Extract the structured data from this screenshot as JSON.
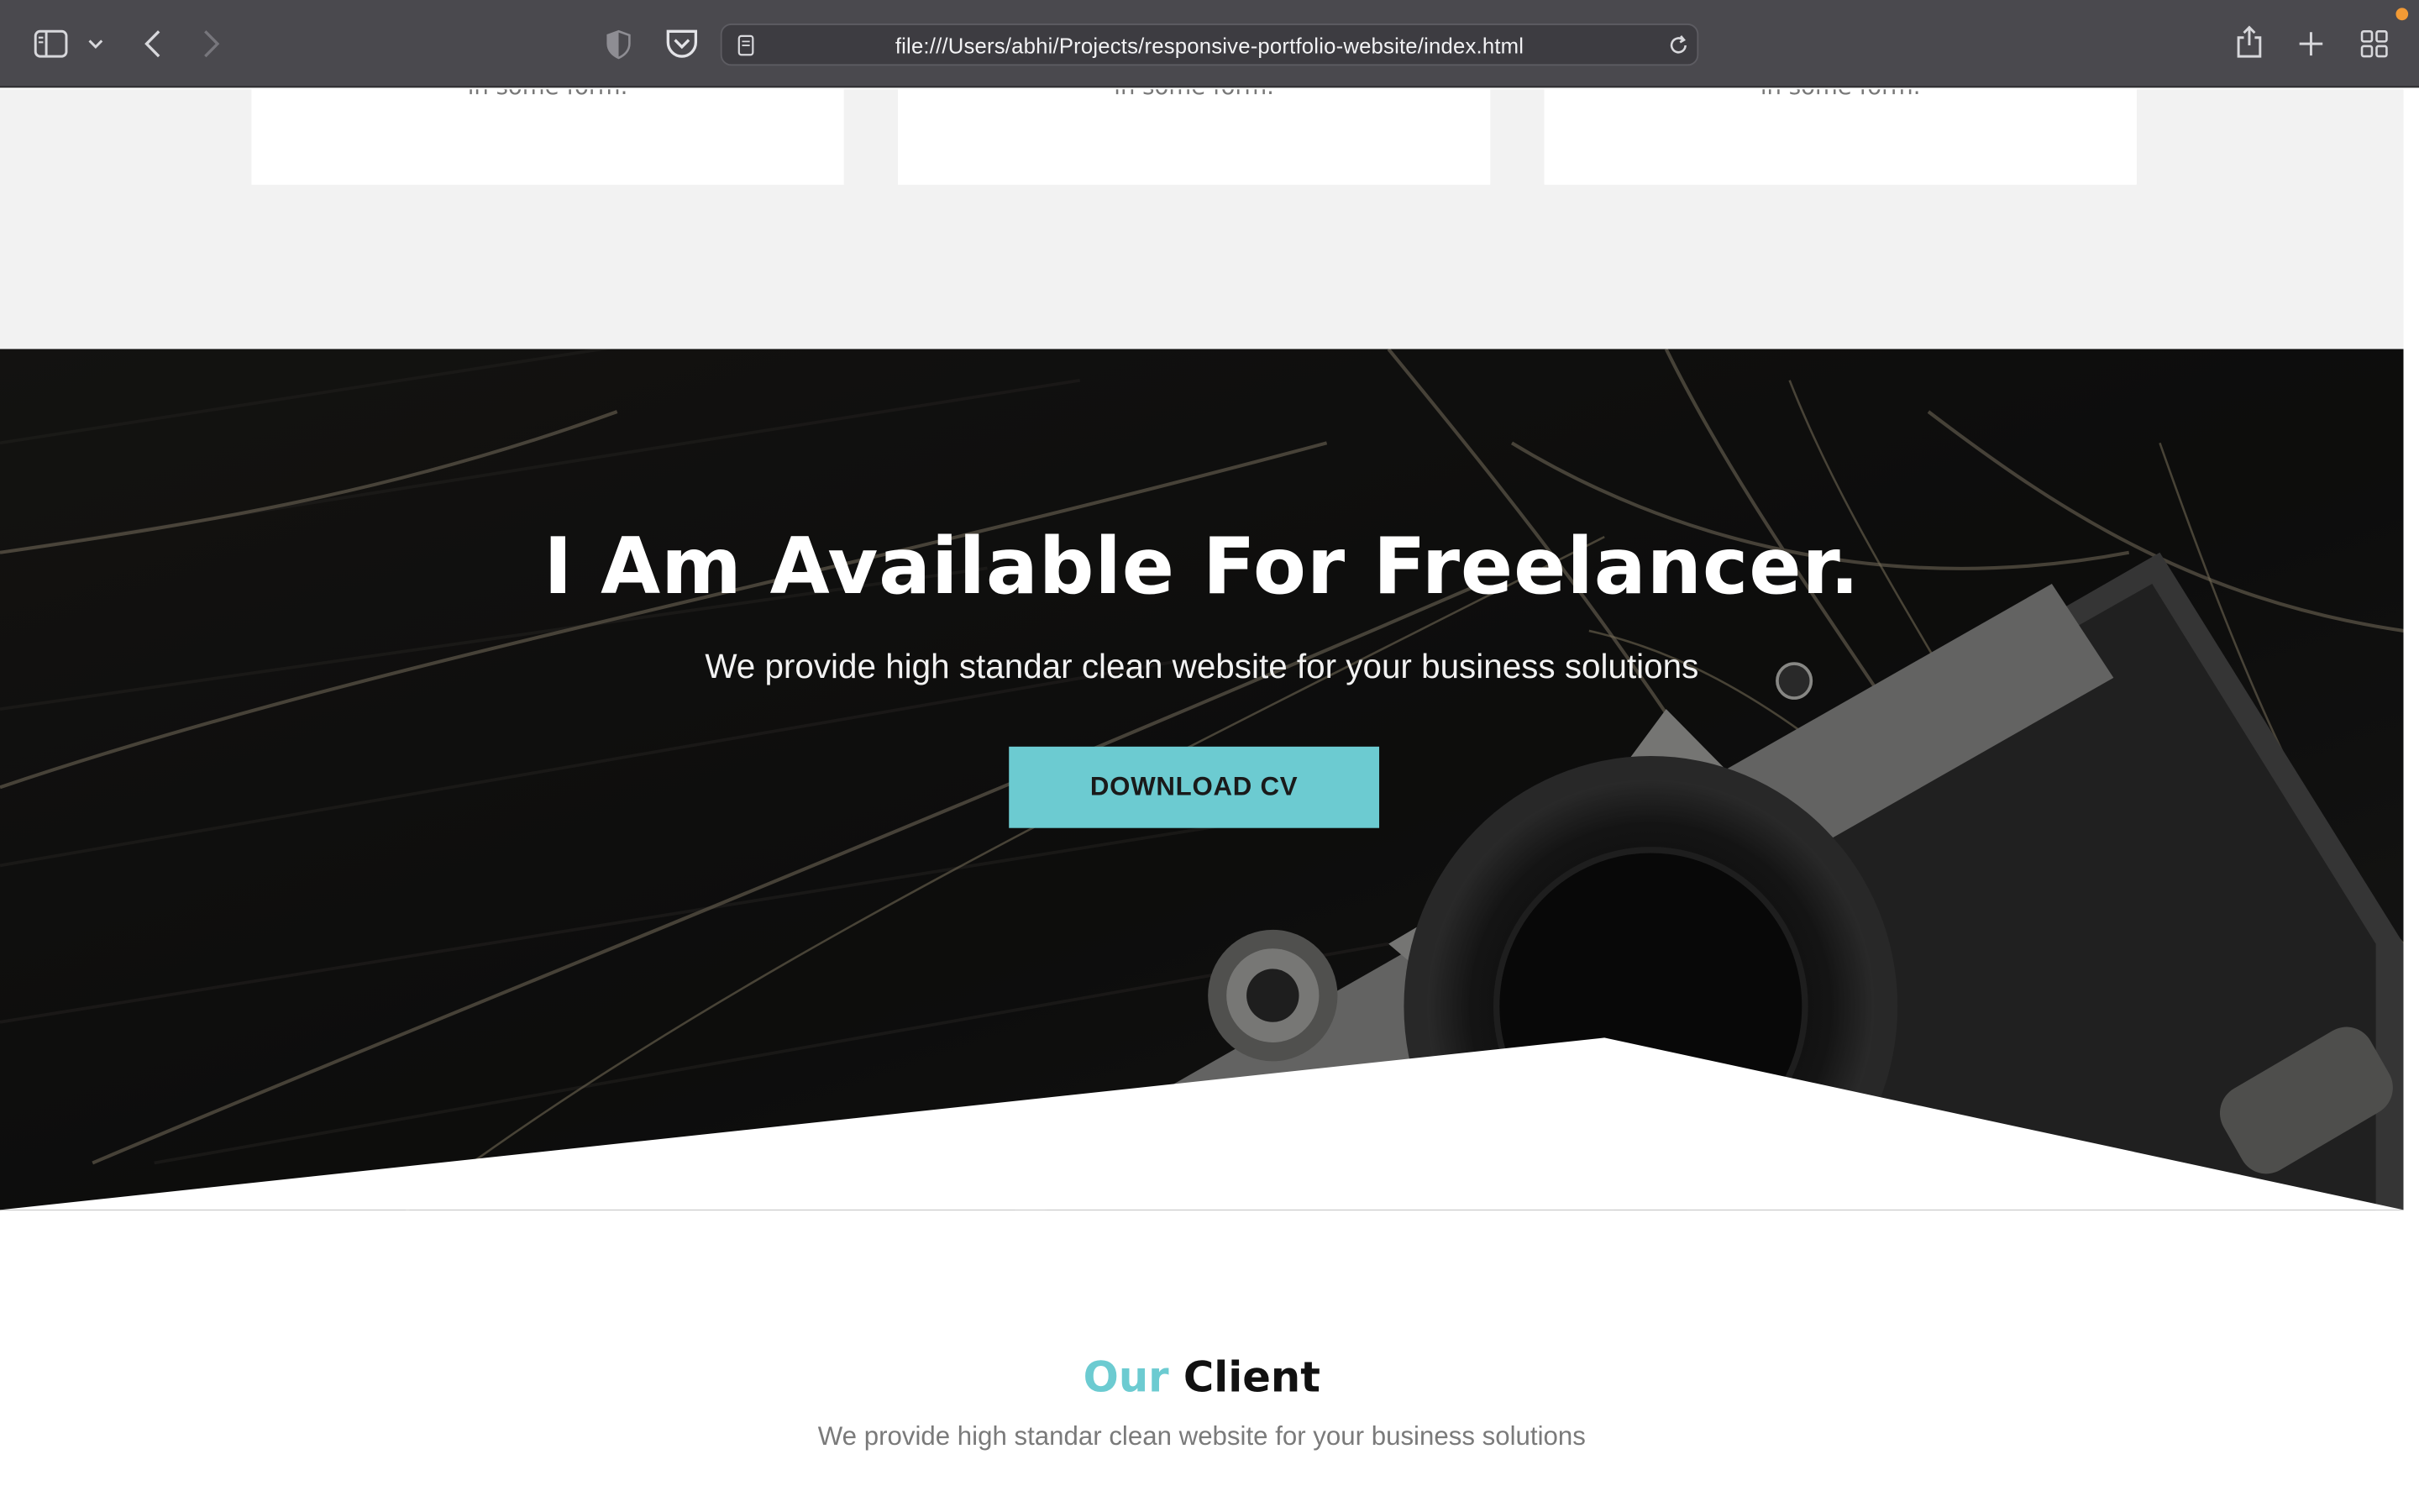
{
  "browser": {
    "url": "file:///Users/abhi/Projects/responsive-portfolio-website/index.html",
    "icons": {
      "sidebar": "sidebar-icon",
      "chevron": "chevron-down-icon",
      "back": "back-arrow-icon",
      "forward": "forward-arrow-icon",
      "privacy": "privacy-shield-icon",
      "pocket": "pocket-icon",
      "page": "page-icon",
      "reload": "reload-icon",
      "share": "share-icon",
      "new_tab": "plus-icon",
      "tab_overview": "tab-overview-icon"
    }
  },
  "services": {
    "cards": [
      {
        "text": "in some form."
      },
      {
        "text": "in some form."
      },
      {
        "text": "in some form."
      }
    ]
  },
  "hero": {
    "title": "I Am Available For Freelancer.",
    "subtitle": "We provide high standar clean website for your business solutions",
    "button_label": "DOWNLOAD CV"
  },
  "clients": {
    "title_accent": "Our",
    "title_rest": "Client",
    "subtitle": "We provide high standar clean website for your business solutions"
  },
  "colors": {
    "accent": "#6ccbd1",
    "toolbar": "#4a494e",
    "section_gray": "#f2f2f2",
    "hero_dark": "#141414"
  }
}
